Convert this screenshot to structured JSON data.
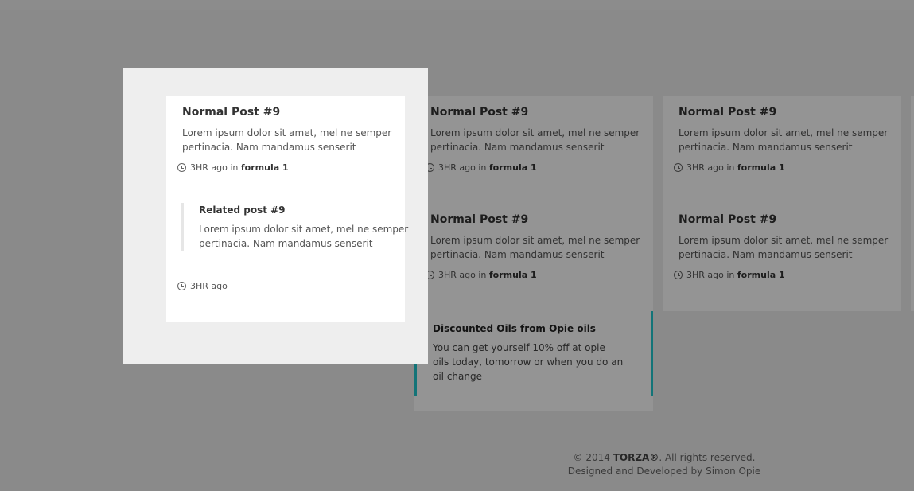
{
  "posts": {
    "p1": {
      "title": "Normal Post #9",
      "excerpt": "Lorem ipsum dolor sit amet, mel ne semper pertinacia. Nam mandamus senserit",
      "time": "3HR ago in",
      "category": "formula 1"
    },
    "p2": {
      "title": "Normal Post #9",
      "excerpt": "Lorem ipsum dolor sit amet, mel ne semper pertinacia. Nam mandamus senserit",
      "time": "3HR ago in",
      "category": "formula 1"
    },
    "p3": {
      "title": "Normal Post #9",
      "excerpt": "Lorem ipsum dolor sit amet, mel ne semper pertinacia. Nam mandamus senserit",
      "time": "3HR ago in",
      "category": "formula 1"
    },
    "p4": {
      "title": "Normal Post #9",
      "excerpt": "Lorem ipsum dolor sit amet, mel ne semper pertinacia. Nam mandamus senserit",
      "time": "3HR ago in",
      "category": "formula 1"
    },
    "p5": {
      "title": "Normal Post #9",
      "excerpt": "Lorem ipsum dolor sit amet, mel ne semper pertinacia. Nam mandamus senserit",
      "time": "3HR ago in",
      "category": "formula 1"
    }
  },
  "related": {
    "title": "Related post #9",
    "excerpt": "Lorem ipsum dolor sit amet, mel ne semper pertinacia. Nam mandamus senserit",
    "time": "3HR ago"
  },
  "promo": {
    "title": "Discounted Oils from Opie oils",
    "text": "You can get yourself 10% off at opie oils today, tomorrow or when you do an oil change",
    "accent_color": "#22c8cf"
  },
  "footer": {
    "copyright_prefix": "© 2014",
    "brand": "TORZA®",
    "copyright_suffix": ". All rights reserved.",
    "credit": "Designed and Developed by Simon Opie"
  },
  "icons": {
    "clock": "clock-icon"
  }
}
